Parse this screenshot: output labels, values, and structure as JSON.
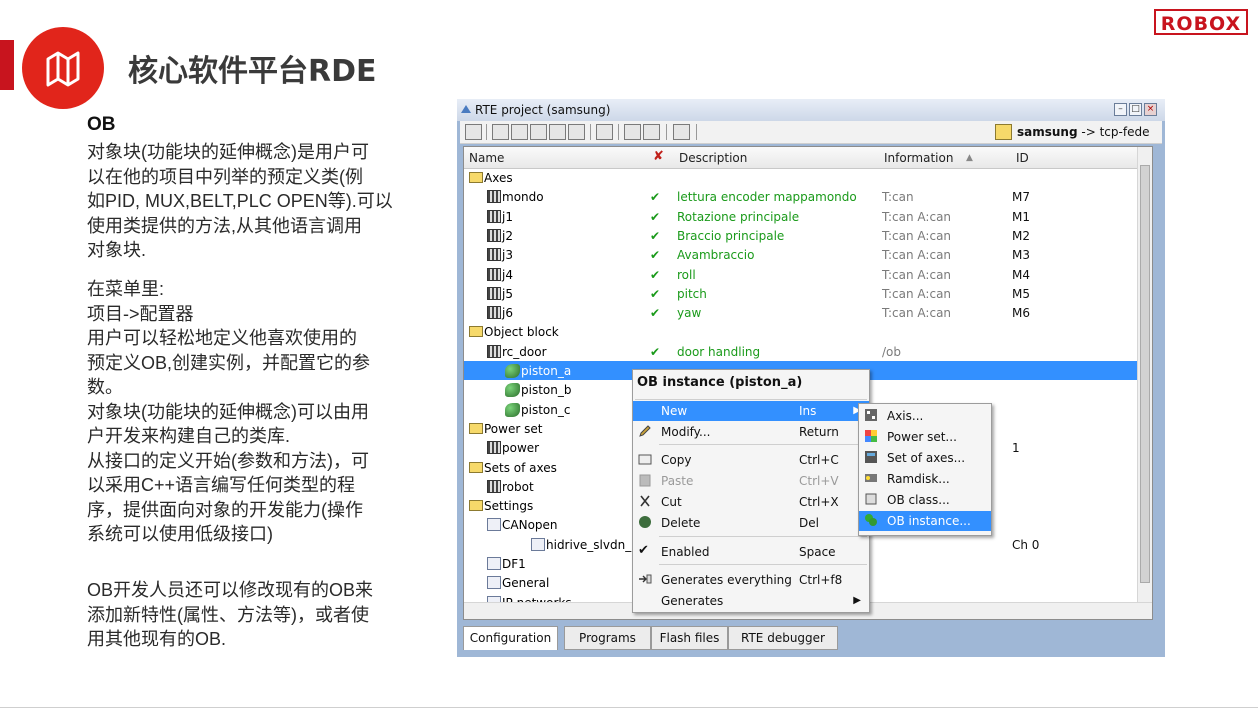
{
  "brand": {
    "logo_text": "ROBOX",
    "accent": "#e1251b"
  },
  "page": {
    "title": "核心软件平台RDE"
  },
  "left_panel": {
    "heading": "OB",
    "paragraph1": [
      "对象块(功能块的延伸概念)是用户可",
      "以在他的项目中列举的预定义类(例",
      "如PID, MUX,BELT,PLC OPEN等).可以",
      "使用类提供的方法,从其他语言调用",
      "对象块."
    ],
    "paragraph2": [
      "在菜单里:",
      "项目->配置器",
      "用户可以轻松地定义他喜欢使用的",
      "预定义OB,创建实例，并配置它的参",
      "数。",
      "对象块(功能块的延伸概念)可以由用",
      "户开发来构建自己的类库.",
      "从接口的定义开始(参数和方法)，可",
      "以采用C++语言编写任何类型的程",
      "序，提供面向对象的开发能力(操作",
      "系统可以使用低级接口)"
    ],
    "paragraph3": [
      "OB开发人员还可以修改现有的OB来",
      "添加新特性(属性、方法等)，或者使",
      "用其他现有的OB."
    ]
  },
  "window": {
    "title": "RTE project (samsung)",
    "project_name": "samsung",
    "project_target": "-> tcp-fede",
    "columns": [
      "Name",
      "Description",
      "Information",
      "ID"
    ],
    "rows": [
      {
        "name": "Axes",
        "type": "folder",
        "desc": "",
        "info": "",
        "id": ""
      },
      {
        "name": "mondo",
        "type": "axis",
        "desc": "lettura encoder mappamondo",
        "info": "T:can",
        "id": "M7"
      },
      {
        "name": "j1",
        "type": "axis",
        "desc": "Rotazione principale",
        "info": "T:can A:can",
        "id": "M1"
      },
      {
        "name": "j2",
        "type": "axis",
        "desc": "Braccio principale",
        "info": "T:can A:can",
        "id": "M2"
      },
      {
        "name": "j3",
        "type": "axis",
        "desc": "Avambraccio",
        "info": "T:can A:can",
        "id": "M3"
      },
      {
        "name": "j4",
        "type": "axis",
        "desc": "roll",
        "info": "T:can A:can",
        "id": "M4"
      },
      {
        "name": "j5",
        "type": "axis",
        "desc": "pitch",
        "info": "T:can A:can",
        "id": "M5"
      },
      {
        "name": "j6",
        "type": "axis",
        "desc": "yaw",
        "info": "T:can A:can",
        "id": "M6"
      },
      {
        "name": "Object block",
        "type": "folder",
        "desc": "",
        "info": "",
        "id": ""
      },
      {
        "name": "rc_door",
        "type": "obclass",
        "desc": "door handling",
        "info": "/ob",
        "id": ""
      },
      {
        "name": "piston_a",
        "type": "ob",
        "desc": "",
        "info": "",
        "id": ""
      },
      {
        "name": "piston_b",
        "type": "ob",
        "desc": "",
        "info": "",
        "id": ""
      },
      {
        "name": "piston_c",
        "type": "ob",
        "desc": "",
        "info": "",
        "id": ""
      },
      {
        "name": "Power set",
        "type": "folder",
        "desc": "",
        "info": "",
        "id": ""
      },
      {
        "name": "power",
        "type": "axis",
        "desc": "",
        "info": "",
        "id": "1"
      },
      {
        "name": "Sets of axes",
        "type": "folder",
        "desc": "",
        "info": "",
        "id": ""
      },
      {
        "name": "robot",
        "type": "axis",
        "desc": "",
        "info": "",
        "id": ""
      },
      {
        "name": "Settings",
        "type": "folder",
        "desc": "",
        "info": "",
        "id": ""
      },
      {
        "name": "CANopen",
        "type": "setting",
        "desc": "",
        "info": "",
        "id": ""
      },
      {
        "name": "hidrive_slvdn_",
        "type": "file",
        "desc": "",
        "info": "",
        "id": "Ch 0"
      },
      {
        "name": "DF1",
        "type": "setting",
        "desc": "",
        "info": "",
        "id": ""
      },
      {
        "name": "General",
        "type": "setting",
        "desc": "",
        "info": "",
        "id": ""
      },
      {
        "name": "IP networks",
        "type": "setting",
        "desc": "",
        "info": "",
        "id": ""
      }
    ],
    "tabs": [
      "Configuration",
      "Programs",
      "Flash files",
      "RTE debugger"
    ]
  },
  "context_menu": {
    "title": "OB instance (piston_a)",
    "items": [
      {
        "label": "New",
        "accel": "Ins"
      },
      {
        "label": "Modify...",
        "accel": "Return"
      },
      {
        "label": "Copy",
        "accel": "Ctrl+C"
      },
      {
        "label": "Paste",
        "accel": "Ctrl+V"
      },
      {
        "label": "Cut",
        "accel": "Ctrl+X"
      },
      {
        "label": "Delete",
        "accel": "Del"
      },
      {
        "label": "Enabled",
        "accel": "Space"
      },
      {
        "label": "Generates everything",
        "accel": "Ctrl+f8"
      },
      {
        "label": "Generates",
        "accel": ""
      }
    ]
  },
  "submenu": {
    "items": [
      "Axis...",
      "Power set...",
      "Set of axes...",
      "Ramdisk...",
      "OB class...",
      "OB instance..."
    ]
  }
}
